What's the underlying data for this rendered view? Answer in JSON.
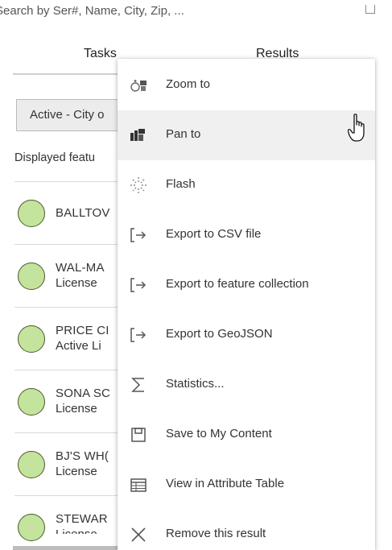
{
  "search": {
    "placeholder": "Search by Ser#, Name, City, Zip, ..."
  },
  "tabs": [
    {
      "label": "Tasks"
    },
    {
      "label": "Results"
    }
  ],
  "layer_select": {
    "value": "Active - City o"
  },
  "displayed_label": "Displayed featu",
  "results": [
    {
      "name": "BALLTOV",
      "sub": ""
    },
    {
      "name": "WAL-MA",
      "sub": "License"
    },
    {
      "name": "PRICE CI",
      "sub": "Active Li"
    },
    {
      "name": "SONA SC",
      "sub": "License"
    },
    {
      "name": "BJ'S WH(",
      "sub": "License"
    },
    {
      "name": "STEWAR",
      "sub": "License"
    }
  ],
  "colors": {
    "result_dot_fill": "#c4e39c",
    "result_dot_stroke": "#4b5a2c",
    "menu_hover": "#f0f0f0"
  },
  "context_menu": {
    "items": [
      {
        "label": "Zoom to",
        "icon": "zoom-to-icon"
      },
      {
        "label": "Pan to",
        "icon": "pan-to-icon",
        "hovered": true
      },
      {
        "label": "Flash",
        "icon": "flash-icon"
      },
      {
        "label": "Export to CSV file",
        "icon": "export-icon"
      },
      {
        "label": "Export to feature collection",
        "icon": "export-icon"
      },
      {
        "label": "Export to GeoJSON",
        "icon": "export-icon"
      },
      {
        "label": "Statistics...",
        "icon": "sigma-icon"
      },
      {
        "label": "Save to My Content",
        "icon": "save-icon"
      },
      {
        "label": "View in Attribute Table",
        "icon": "table-icon"
      },
      {
        "label": "Remove this result",
        "icon": "close-icon"
      }
    ]
  }
}
